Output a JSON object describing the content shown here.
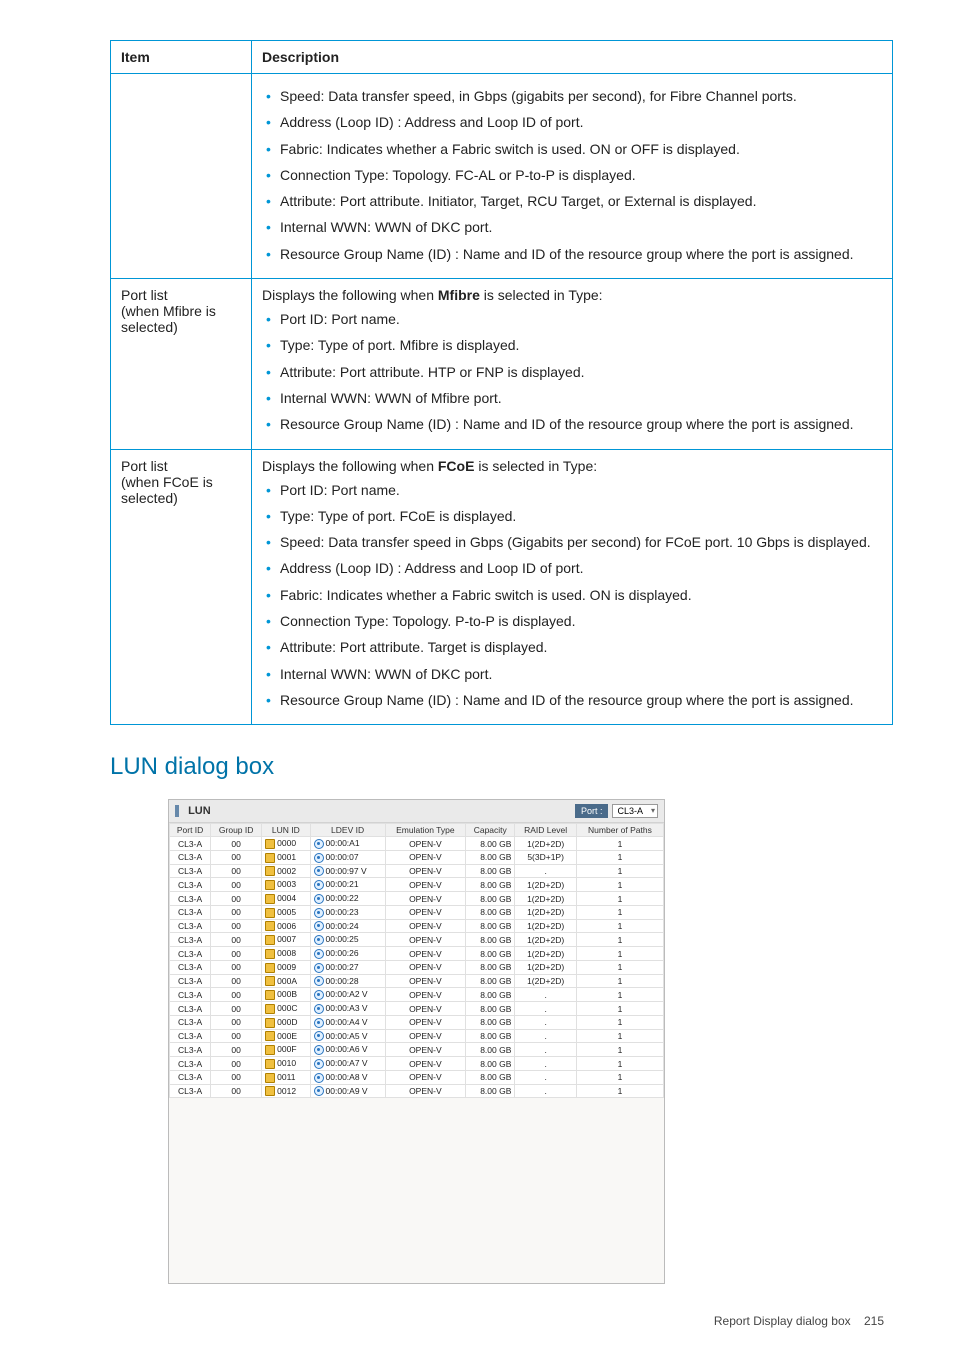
{
  "table": {
    "headers": {
      "item": "Item",
      "description": "Description"
    },
    "rows": [
      {
        "item": "",
        "intro": "",
        "bullets": [
          "Speed: Data transfer speed, in Gbps (gigabits per second), for Fibre Channel ports.",
          "Address (Loop ID) : Address and Loop ID of port.",
          "Fabric: Indicates whether a Fabric switch is used. ON or OFF is displayed.",
          "Connection Type: Topology. FC-AL or P-to-P is displayed.",
          "Attribute: Port attribute. Initiator, Target, RCU Target, or External is displayed.",
          "Internal WWN: WWN of DKC port.",
          "Resource Group Name (ID) : Name and ID of the resource group where the port is assigned."
        ]
      },
      {
        "item": "Port list\n(when Mfibre is selected)",
        "intro": "Displays the following when ",
        "intro_bold": "Mfibre",
        "intro_tail": " is selected in Type:",
        "bullets": [
          "Port ID: Port name.",
          "Type: Type of port. Mfibre is displayed.",
          "Attribute: Port attribute. HTP or FNP is displayed.",
          "Internal WWN: WWN of Mfibre port.",
          "Resource Group Name (ID) : Name and ID of the resource group where the port is assigned."
        ]
      },
      {
        "item": "Port list\n(when FCoE is selected)",
        "intro": "Displays the following when ",
        "intro_bold": "FCoE",
        "intro_tail": " is selected in Type:",
        "bullets": [
          "Port ID: Port name.",
          "Type: Type of port. FCoE is displayed.",
          "Speed: Data transfer speed in Gbps (Gigabits per second) for FCoE port. 10 Gbps is displayed.",
          "Address (Loop ID) : Address and Loop ID of port.",
          "Fabric: Indicates whether a Fabric switch is used. ON is displayed.",
          "Connection Type: Topology. P-to-P is displayed.",
          "Attribute: Port attribute. Target is displayed.",
          "Internal WWN: WWN of DKC port.",
          "Resource Group Name (ID) : Name and ID of the resource group where the port is assigned."
        ]
      }
    ]
  },
  "section_heading": "LUN dialog box",
  "lun_dialog": {
    "title": "LUN",
    "port_label": "Port :",
    "port_value": "CL3-A",
    "headers": [
      "Port ID",
      "Group ID",
      "LUN ID",
      "LDEV ID",
      "Emulation Type",
      "Capacity",
      "RAID Level",
      "Number of Paths"
    ],
    "rows": [
      [
        "CL3-A",
        "00",
        "0000",
        "00:00:A1",
        "OPEN-V",
        "8.00 GB",
        "1(2D+2D)",
        "1"
      ],
      [
        "CL3-A",
        "00",
        "0001",
        "00:00:07",
        "OPEN-V",
        "8.00 GB",
        "5(3D+1P)",
        "1"
      ],
      [
        "CL3-A",
        "00",
        "0002",
        "00:00:97 V",
        "OPEN-V",
        "8.00 GB",
        ".",
        "1"
      ],
      [
        "CL3-A",
        "00",
        "0003",
        "00:00:21",
        "OPEN-V",
        "8.00 GB",
        "1(2D+2D)",
        "1"
      ],
      [
        "CL3-A",
        "00",
        "0004",
        "00:00:22",
        "OPEN-V",
        "8.00 GB",
        "1(2D+2D)",
        "1"
      ],
      [
        "CL3-A",
        "00",
        "0005",
        "00:00:23",
        "OPEN-V",
        "8.00 GB",
        "1(2D+2D)",
        "1"
      ],
      [
        "CL3-A",
        "00",
        "0006",
        "00:00:24",
        "OPEN-V",
        "8.00 GB",
        "1(2D+2D)",
        "1"
      ],
      [
        "CL3-A",
        "00",
        "0007",
        "00:00:25",
        "OPEN-V",
        "8.00 GB",
        "1(2D+2D)",
        "1"
      ],
      [
        "CL3-A",
        "00",
        "0008",
        "00:00:26",
        "OPEN-V",
        "8.00 GB",
        "1(2D+2D)",
        "1"
      ],
      [
        "CL3-A",
        "00",
        "0009",
        "00:00:27",
        "OPEN-V",
        "8.00 GB",
        "1(2D+2D)",
        "1"
      ],
      [
        "CL3-A",
        "00",
        "000A",
        "00:00:28",
        "OPEN-V",
        "8.00 GB",
        "1(2D+2D)",
        "1"
      ],
      [
        "CL3-A",
        "00",
        "000B",
        "00:00:A2 V",
        "OPEN-V",
        "8.00 GB",
        ".",
        "1"
      ],
      [
        "CL3-A",
        "00",
        "000C",
        "00:00:A3 V",
        "OPEN-V",
        "8.00 GB",
        ".",
        "1"
      ],
      [
        "CL3-A",
        "00",
        "000D",
        "00:00:A4 V",
        "OPEN-V",
        "8.00 GB",
        ".",
        "1"
      ],
      [
        "CL3-A",
        "00",
        "000E",
        "00:00:A5 V",
        "OPEN-V",
        "8.00 GB",
        ".",
        "1"
      ],
      [
        "CL3-A",
        "00",
        "000F",
        "00:00:A6 V",
        "OPEN-V",
        "8.00 GB",
        ".",
        "1"
      ],
      [
        "CL3-A",
        "00",
        "0010",
        "00:00:A7 V",
        "OPEN-V",
        "8.00 GB",
        ".",
        "1"
      ],
      [
        "CL3-A",
        "00",
        "0011",
        "00:00:A8 V",
        "OPEN-V",
        "8.00 GB",
        ".",
        "1"
      ],
      [
        "CL3-A",
        "00",
        "0012",
        "00:00:A9 V",
        "OPEN-V",
        "8.00 GB",
        ".",
        "1"
      ]
    ]
  },
  "footer": {
    "text": "Report Display dialog box",
    "page": "215"
  }
}
